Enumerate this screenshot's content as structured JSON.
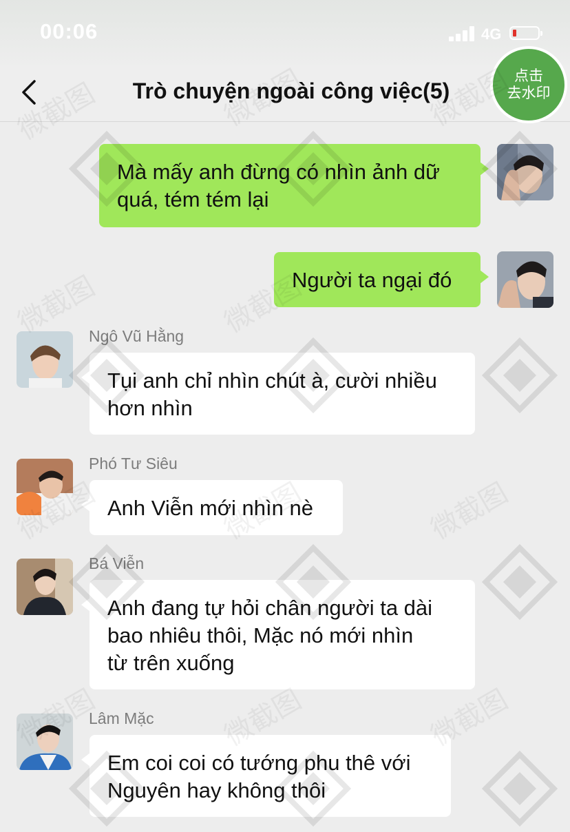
{
  "status_bar": {
    "time": "00:06",
    "network": "4G",
    "battery_color": "#e0322a"
  },
  "header": {
    "title": "Trò chuyện ngoài công việc(5)",
    "watermark_button": "点击\n去水印",
    "back_icon": "chevron-left-icon"
  },
  "messages": [
    {
      "side": "me",
      "text": "Mà mấy anh đừng có nhìn ảnh dữ\nquá, tém tém lại"
    },
    {
      "side": "me",
      "text": "Người ta ngại đó"
    },
    {
      "side": "other",
      "sender": "Ngô Vũ Hằng",
      "text": "Tụi anh chỉ nhìn chút à, cười nhiều\nhơn nhìn"
    },
    {
      "side": "other",
      "sender": "Phó Tư Siêu",
      "text": "Anh Viễn mới nhìn nè"
    },
    {
      "side": "other",
      "sender": "Bá Viễn",
      "text": "Anh đang tự hỏi chân người ta dài\nbao nhiêu thôi, Mặc nó mới nhìn\ntừ trên xuống"
    },
    {
      "side": "other",
      "sender": "Lâm Mặc",
      "text": "Em coi coi có tướng phu thê với\nNguyên hay không thôi"
    }
  ],
  "watermark": {
    "text": "微截图",
    "url": "www.vjietu.com"
  },
  "colors": {
    "my_bubble": "#a0e75a",
    "other_bubble": "#ffffff",
    "background": "#ededed",
    "badge": "#56a84c"
  }
}
